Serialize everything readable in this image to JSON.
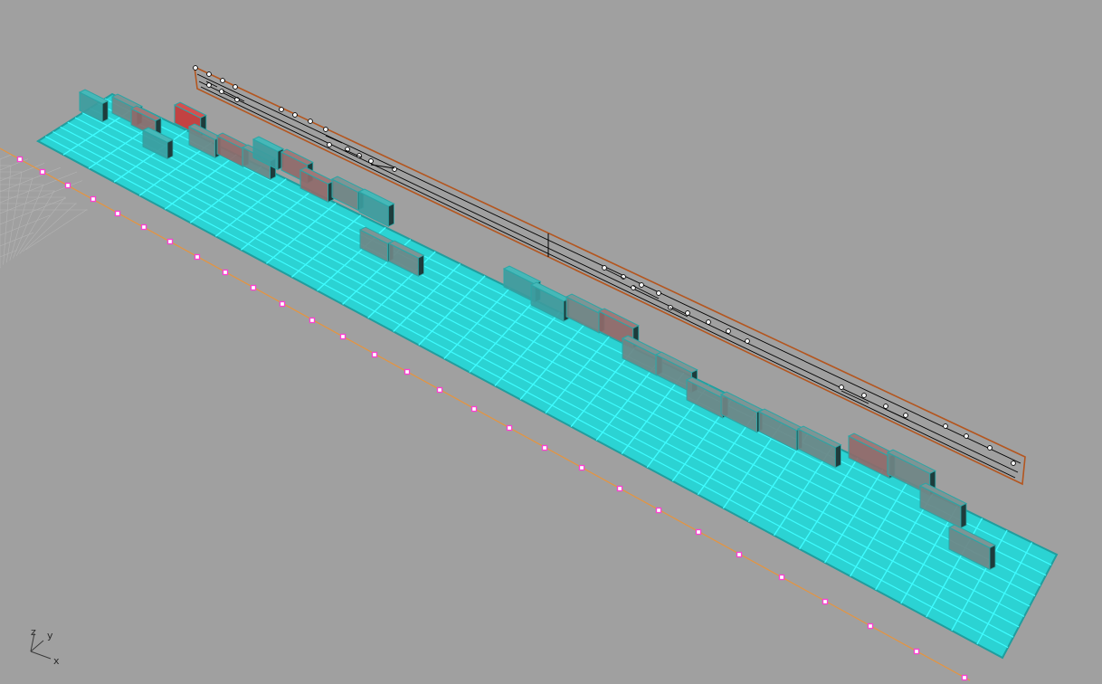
{
  "viewport": {
    "background": "#a0a0a0",
    "grid_color": "#b4b4b4"
  },
  "floor": {
    "fill": "#2bd3d3",
    "line": "#3ffcff",
    "edge": "#1f9e9e"
  },
  "blocks": {
    "cyan_top": "#46b8b8",
    "cyan_front": "#3c9c9e",
    "gray_front": "#6f8585",
    "gray_top": "#7d9595",
    "red_front": "#8f6a6a",
    "red_top": "#a07878",
    "bright_red": "#c43a3a",
    "outline": "#2aa6a6"
  },
  "path": {
    "line_color": "#e7943d",
    "point_color": "#ff3ed3"
  },
  "curve": {
    "color": "#000000",
    "highlight": "#b4561f"
  },
  "axis_gizmo": {
    "z_label": "z",
    "y_label": "y",
    "x_label": "x",
    "color": "#3a3a3a"
  }
}
